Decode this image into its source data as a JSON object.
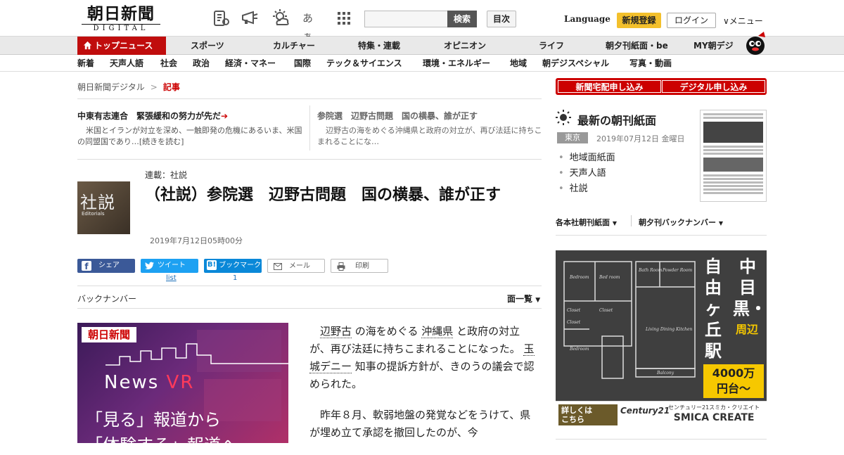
{
  "header": {
    "logo_jp": "朝日新聞",
    "logo_en": "DIGITAL",
    "search_button": "検索",
    "toc_button": "目次",
    "language": "Language",
    "register": "新規登録",
    "login": "ログイン",
    "menu": "メニュー",
    "icons": [
      "newspaper-icon",
      "megaphone-icon",
      "weather-icon",
      "font-size-icon",
      "grid-icon"
    ],
    "font_size_glyph": "あぁ"
  },
  "nav_primary": {
    "top_news": "トップニュース",
    "items": [
      "スポーツ",
      "カルチャー",
      "特集・連載",
      "オピニオン",
      "ライフ",
      "朝夕刊紙面・be",
      "MY朝デジ"
    ]
  },
  "nav_secondary": {
    "items": [
      "新着",
      "天声人語",
      "社会",
      "政治",
      "経済・マネー",
      "国際",
      "テック＆サイエンス",
      "環境・エネルギー",
      "地域",
      "朝デジスペシャル",
      "写真・動画"
    ]
  },
  "breadcrumb": {
    "home": "朝日新聞デジタル",
    "sep": ">",
    "current": "記事"
  },
  "related": [
    {
      "title": "中東有志連合　緊張緩和の努力が先だ",
      "body": "米国とイランが対立を深め、一触即発の危機にあるいま、米国の同盟国であり…[続きを読む]"
    },
    {
      "title": "参院選　辺野古問題　国の横暴、誰が正す",
      "body": "辺野古の海をめぐる沖縄県と政府の対立が、再び法廷に持ちこまれることにな…"
    }
  ],
  "article": {
    "thumb_kanji": "社説",
    "thumb_en": "Editorials",
    "series": "連載：社説",
    "title": "（社説）参院選　辺野古問題　国の横暴、誰が正す",
    "date": "2019年7月12日05時00分",
    "p1": [
      "辺野古",
      "の海をめぐる",
      "沖縄県",
      "と政府の対立が、再び法廷に持ちこまれることになった。",
      "玉城デニー",
      "知事の提訴方針が、きのうの議会で認められた。"
    ],
    "p2": "昨年８月、軟弱地盤の発覚などをうけて、県が埋め立て承認を撤回したのが、今"
  },
  "share": {
    "facebook": "シェア",
    "twitter": "ツイート",
    "twitter_count": "list",
    "hatena": "ブックマーク",
    "hatena_count": "1",
    "mail": "メール",
    "print": "印刷"
  },
  "backnumber": "バックナンバー",
  "men_list": "面一覧",
  "ad_left": {
    "logo": "朝日新聞",
    "news": "News ",
    "vr": "VR",
    "line1": "「見る」報道から",
    "line2": "「体験する」報道へ"
  },
  "sidebar": {
    "sub_home": "新聞宅配申し込み",
    "sub_digital": "デジタル申し込み",
    "paper_heading": "最新の朝刊紙面",
    "region": "東京",
    "paper_date": "2019年07月12日 金曜日",
    "paper_links": [
      "地域面紙面",
      "天声人語",
      "社説"
    ],
    "select1": "各本社朝刊紙面",
    "select2": "朝夕刊バックナンバー"
  },
  "ad_right": {
    "place1": "中目黒・",
    "place2": "自由ヶ丘駅",
    "place_suffix": "周辺",
    "price1": "4000万",
    "price2": "円台～",
    "more1": "詳しくは",
    "more2": "こちら",
    "c21": "Century21",
    "smica_small": "センチュリー21スミカ・クリエイト",
    "smica_big": "SMICA CREATE",
    "plan_labels": [
      "Bedroom",
      "Bed room",
      "Bath Room",
      "Powder Room",
      "Closet",
      "Closet",
      "Closet",
      "Bedroom",
      "Living Dining Kitchen",
      "Balcony"
    ]
  },
  "colors": {
    "brand_red": "#c00d0d",
    "register_yellow": "#f3c02c",
    "facebook": "#3b5998",
    "twitter": "#1da1f2",
    "hatena": "#0a88d8"
  }
}
